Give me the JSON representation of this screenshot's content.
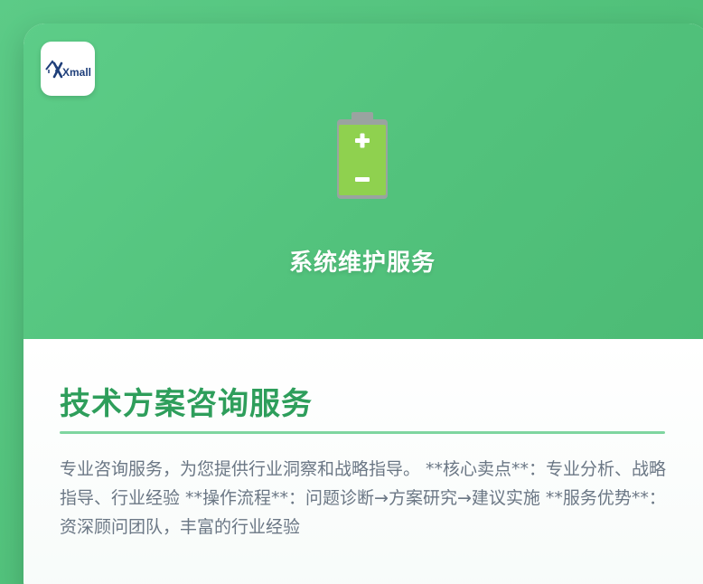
{
  "brand": {
    "logo_text": "Xmall",
    "logo_icon": "xmall-logo-icon"
  },
  "hero": {
    "icon": "battery-icon",
    "title": "系统维护服务"
  },
  "content": {
    "title": "技术方案咨询服务",
    "description": "专业咨询服务，为您提供行业洞察和战略指导。 **核心卖点**：专业分析、战略指导、行业经验 **操作流程**：问题诊断→方案研究→建议实施 **服务优势**：资深顾问团队，丰富的行业经验"
  },
  "colors": {
    "accent": "#2e9e5b",
    "hero_background": "#52c27c",
    "battery_fill": "#8fd14f",
    "text_muted": "#6b7785"
  }
}
